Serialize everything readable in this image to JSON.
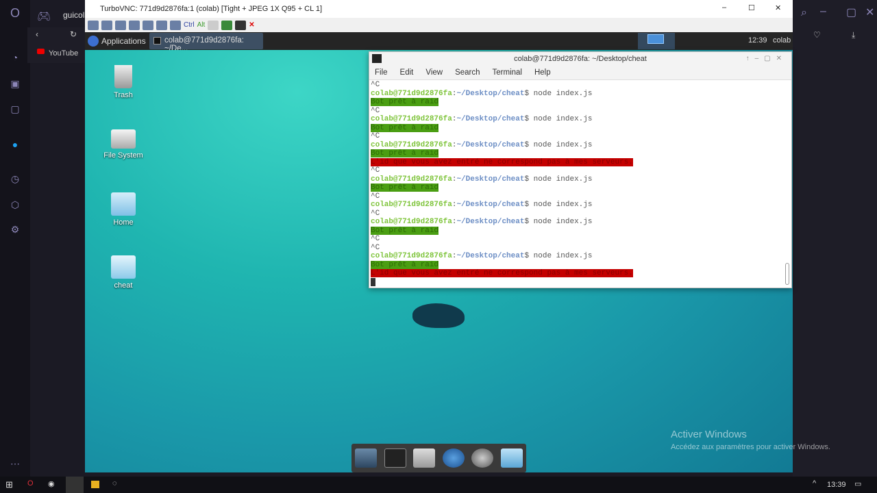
{
  "browser": {
    "tab_label": "guicola",
    "bookmark": "YouTube"
  },
  "vnc": {
    "title": "TurboVNC: 771d9d2876fa:1 (colab) [Tight + JPEG 1X Q95 + CL 1]",
    "ctrl": "Ctrl",
    "alt": "Alt"
  },
  "panel": {
    "applications": "Applications",
    "task": "colab@771d9d2876fa: ~/De...",
    "clock": "12:39",
    "user": "colab"
  },
  "desktop": {
    "icons": [
      {
        "label": "Trash"
      },
      {
        "label": "File System"
      },
      {
        "label": "Home"
      },
      {
        "label": "cheat"
      }
    ]
  },
  "terminal": {
    "title": "colab@771d9d2876fa: ~/Desktop/cheat",
    "menu": [
      "File",
      "Edit",
      "View",
      "Search",
      "Terminal",
      "Help"
    ],
    "user_host": "colab@771d9d2876fa",
    "path": "~/Desktop/cheat",
    "command": "node index.js",
    "ok_msg": "Bot prêt à raid",
    "err_msg": "L'id que vous avez entré ne correspond pas à mes serveurs.",
    "ctrl_c": "^C",
    "lines": [
      "c",
      "p",
      "o",
      "c",
      "p",
      "o",
      "c",
      "p",
      "o",
      "e",
      "c",
      "p",
      "o",
      "c",
      "p",
      "c",
      "p",
      "o",
      "c",
      "c",
      "p",
      "o",
      "e"
    ]
  },
  "watermark": {
    "title": "Activer Windows",
    "subtitle": "Accédez aux paramètres pour activer Windows."
  },
  "taskbar": {
    "clock": "13:39"
  }
}
